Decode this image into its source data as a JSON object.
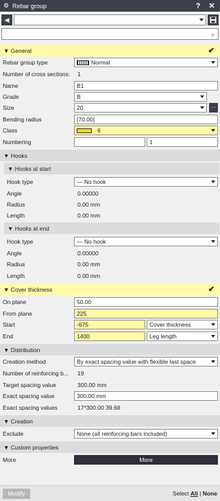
{
  "window": {
    "title": "Rebar group",
    "help": "?",
    "close": "✕"
  },
  "toolbar": {
    "back": "◀",
    "save": "💾",
    "object_combo": ""
  },
  "search": {
    "value": ""
  },
  "general": {
    "title": "General",
    "check": "✔",
    "rows": [
      {
        "label": "Rebar group type",
        "value": "Normal"
      },
      {
        "label": "Number of cross sections:",
        "value": "1"
      },
      {
        "label": "Name",
        "value": "B1"
      },
      {
        "label": "Grade",
        "value": "B"
      },
      {
        "label": "Size",
        "value": "20",
        "button": "..."
      },
      {
        "label": "Bending radius",
        "value": "[70.00]"
      },
      {
        "label": "Class",
        "value": "6",
        "swatch_color": "#f1d81c"
      },
      {
        "label": "Numbering",
        "value": "",
        "value2": "1"
      }
    ]
  },
  "hooks": {
    "title": "Hooks",
    "start": {
      "title": "Hooks at start",
      "rows": [
        {
          "label": "Hook type",
          "value": "— No hook"
        },
        {
          "label": "Angle",
          "value": "0.00000"
        },
        {
          "label": "Radius",
          "value": "0.00 mm"
        },
        {
          "label": "Length",
          "value": "0.00 mm"
        }
      ]
    },
    "end": {
      "title": "Hooks at end",
      "rows": [
        {
          "label": "Hook type",
          "value": "— No hook"
        },
        {
          "label": "Angle",
          "value": "0.00000"
        },
        {
          "label": "Radius",
          "value": "0.00 mm"
        },
        {
          "label": "Length",
          "value": "0.00 mm"
        }
      ]
    }
  },
  "cover": {
    "title": "Cover thickness",
    "check": "✔",
    "rows": [
      {
        "label": "On plane",
        "value": "50.00"
      },
      {
        "label": "From plane",
        "value": "225"
      },
      {
        "label": "Start",
        "value": "-675",
        "option": "Cover thickness"
      },
      {
        "label": "End",
        "value": "1400",
        "option": "Leg length"
      }
    ]
  },
  "distribution": {
    "title": "Distribution",
    "rows": [
      {
        "label": "Creation method",
        "value": "By exact spacing value with flexible last space"
      },
      {
        "label": "Number of reinforcing b...",
        "value": "19"
      },
      {
        "label": "Target spacing value",
        "value": "300.00 mm"
      },
      {
        "label": "Exact spacing value",
        "value": "300.00 mm"
      },
      {
        "label": "Exact spacing values",
        "value": "17*300.00 39.68"
      }
    ]
  },
  "creation": {
    "title": "Creation",
    "rows": [
      {
        "label": "Exclude",
        "value": "None (all reinforcing bars included)"
      }
    ]
  },
  "custom": {
    "title": "Custom properties",
    "rows": [
      {
        "label": "More",
        "button": "More"
      }
    ]
  },
  "footer": {
    "modify": "Modify",
    "select": "Select",
    "all": "All",
    "separator": "|",
    "none": "None"
  },
  "colors": {
    "highlight": "#fff9a8",
    "header": "#dcdcdc",
    "dark": "#3c4049"
  }
}
